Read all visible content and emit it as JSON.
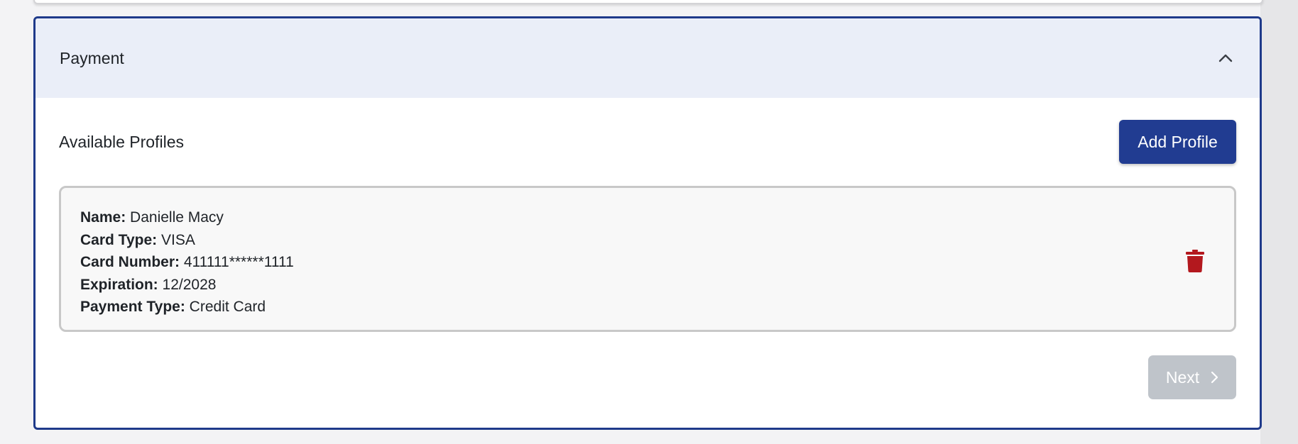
{
  "payment_section": {
    "title": "Payment",
    "collapse_icon": "chevron-up-icon",
    "accent_color": "#1f3a8a",
    "header_bg": "#eaeef8"
  },
  "profiles": {
    "heading": "Available Profiles",
    "add_button_label": "Add Profile",
    "items": [
      {
        "name_label": "Name:",
        "name": "Danielle Macy",
        "card_type_label": "Card Type:",
        "card_type": "VISA",
        "card_number_label": "Card Number:",
        "card_number": "411111******1111",
        "expiration_label": "Expiration:",
        "expiration": "12/2028",
        "payment_type_label": "Payment Type:",
        "payment_type": "Credit Card",
        "delete_icon": "trash-icon",
        "delete_color": "#b3181e"
      }
    ]
  },
  "footer": {
    "next_label": "Next",
    "next_icon": "chevron-right-icon",
    "next_disabled": true
  }
}
